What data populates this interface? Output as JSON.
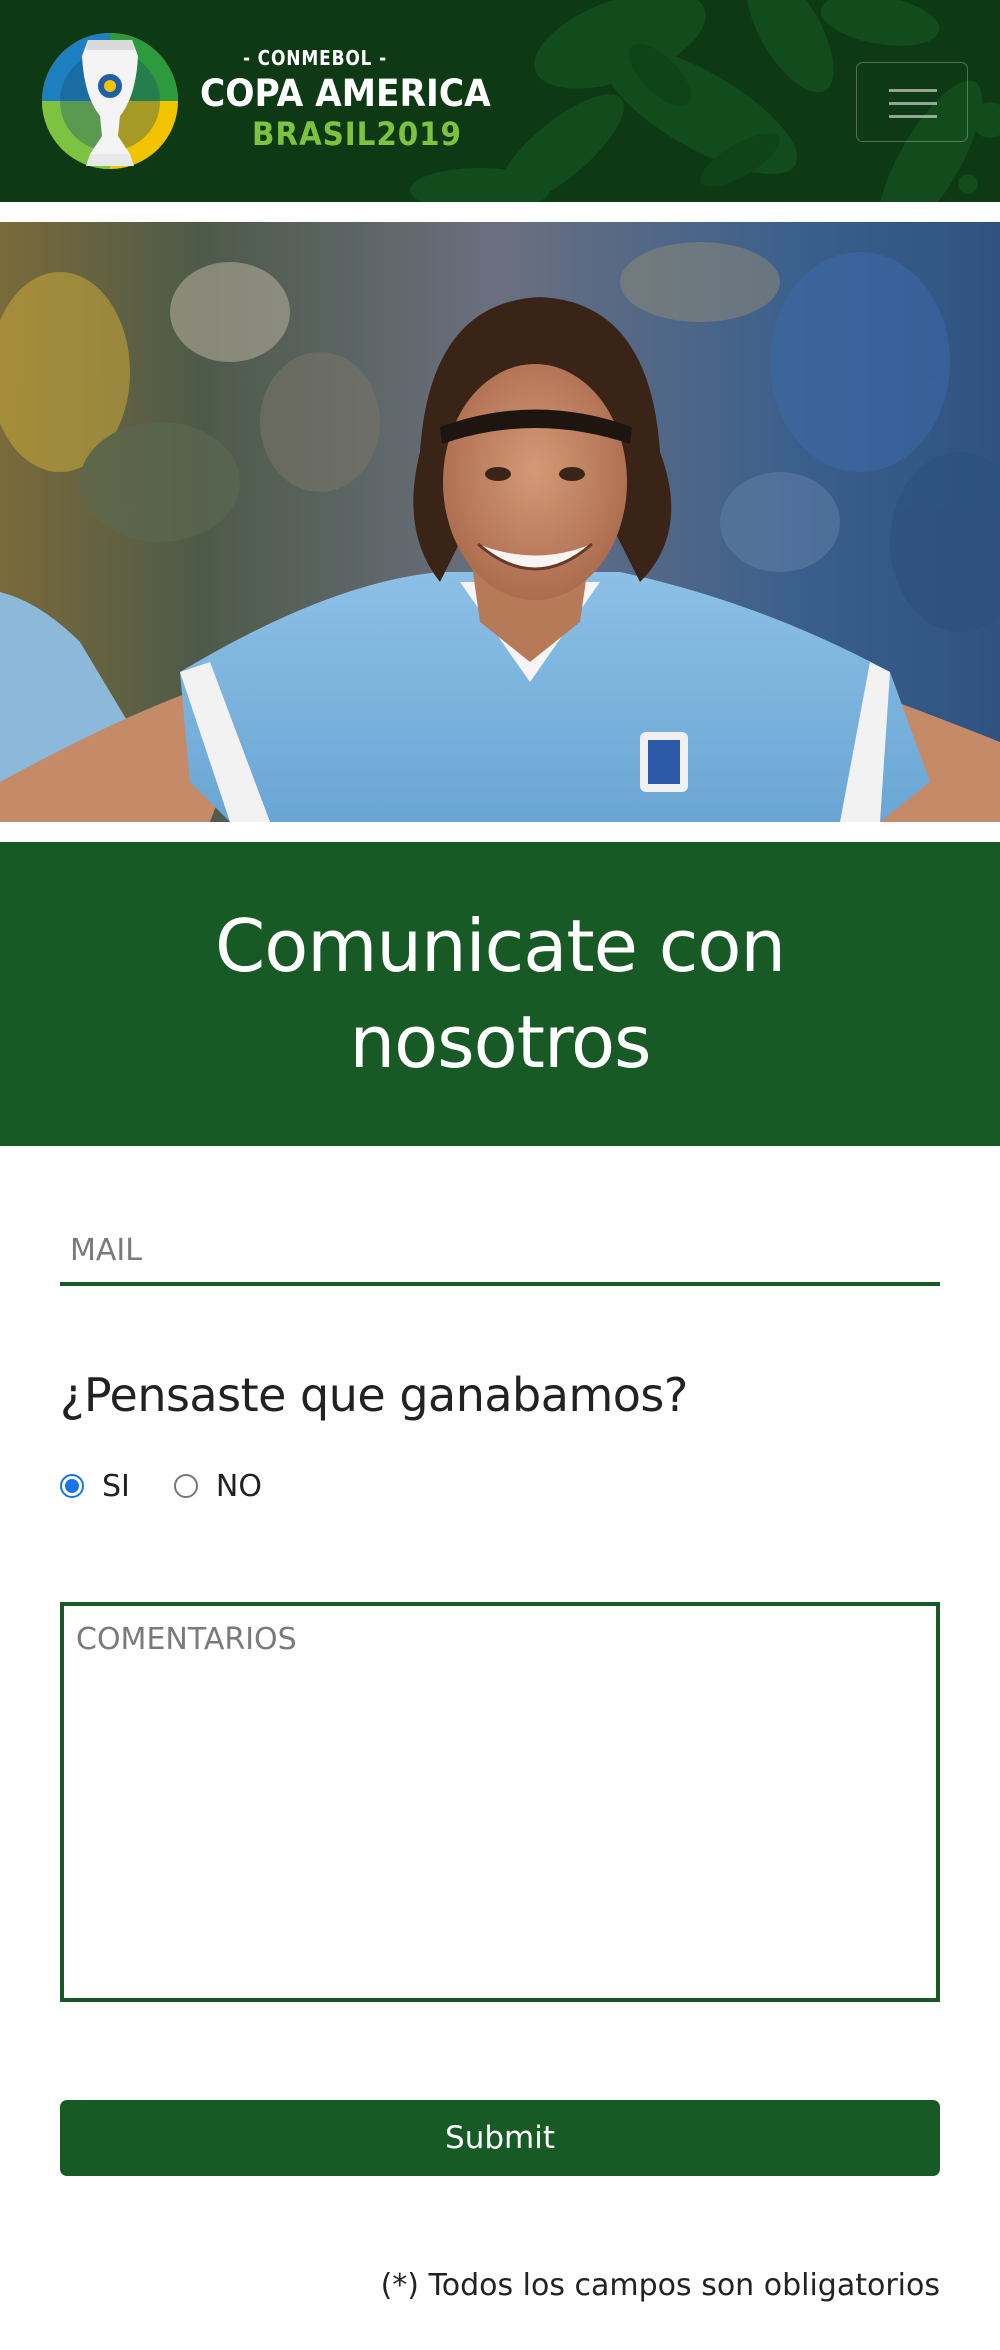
{
  "header": {
    "logo": {
      "line1": "- CONMEBOL -",
      "line2": "COPA AMERICA",
      "line3": "BRASIL2019"
    },
    "menu_icon": "hamburger-icon",
    "colors": {
      "background": "#0d3a14",
      "accent_green": "#7ec242"
    }
  },
  "hero": {
    "image_description_icon": "player-celebrating-photo",
    "colors": {
      "jersey": "#7fb6e0",
      "stadium": "#3b5f8a"
    }
  },
  "banner": {
    "title": "Comunicate con nosotros",
    "color": "#185a26"
  },
  "form": {
    "mail": {
      "placeholder": "MAIL",
      "value": ""
    },
    "question": "¿Pensaste que ganabamos?",
    "options": [
      {
        "label": "SI",
        "checked": true
      },
      {
        "label": "NO",
        "checked": false
      }
    ],
    "comments": {
      "placeholder": "COMENTARIOS",
      "value": ""
    },
    "submit_label": "Submit",
    "note": "(*) Todos los campos son obligatorios"
  }
}
